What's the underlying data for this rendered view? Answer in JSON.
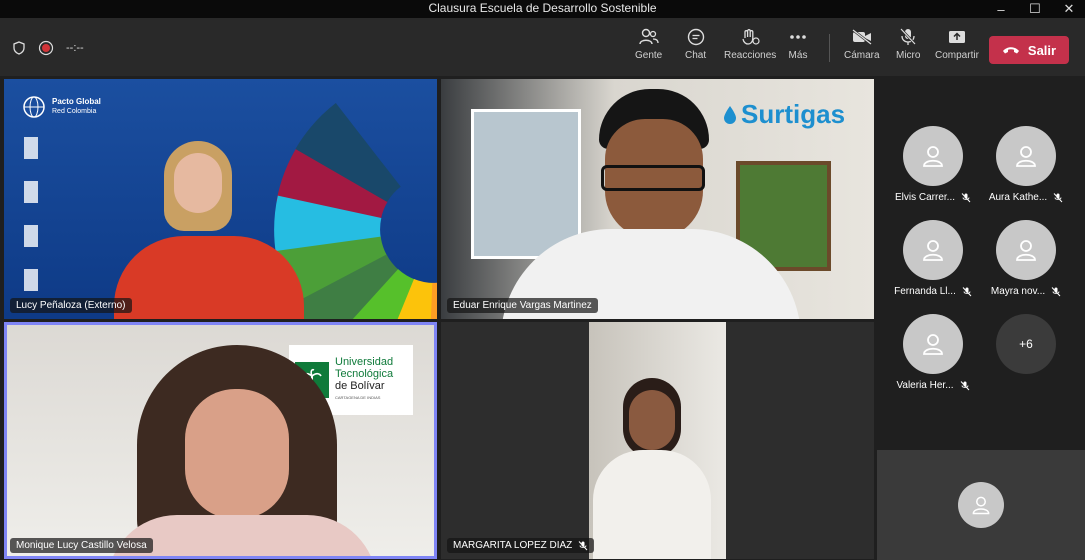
{
  "window": {
    "title": "Clausura Escuela de Desarrollo Sostenible"
  },
  "toolbar": {
    "timer": "--:--",
    "people": "Gente",
    "chat": "Chat",
    "reactions": "Reacciones",
    "more": "Más",
    "camera": "Cámara",
    "mic": "Micro",
    "share": "Compartir",
    "leave": "Salir"
  },
  "tiles": [
    {
      "name": "Lucy Peñaloza (Externo)",
      "org_line1": "Pacto Global",
      "org_line2": "Red Colombia"
    },
    {
      "name": "Eduar Enrique Vargas Martinez",
      "brand": "Surtigas"
    },
    {
      "name": "Monique Lucy Castillo Velosa",
      "uni_line1": "Universidad",
      "uni_line2": "Tecnológica",
      "uni_line3": "de Bolívar",
      "uni_sub": "CARTAGENA DE INDIAS"
    },
    {
      "name": "MARGARITA LOPEZ DIAZ"
    }
  ],
  "participants": [
    {
      "name": "Elvis Carrer..."
    },
    {
      "name": "Aura Kathe..."
    },
    {
      "name": "Fernanda Ll..."
    },
    {
      "name": "Mayra nov..."
    },
    {
      "name": "Valeria Her..."
    }
  ],
  "overflow_count": "+6",
  "colors": {
    "leave": "#c4314b",
    "active_border": "#7f85f5"
  }
}
